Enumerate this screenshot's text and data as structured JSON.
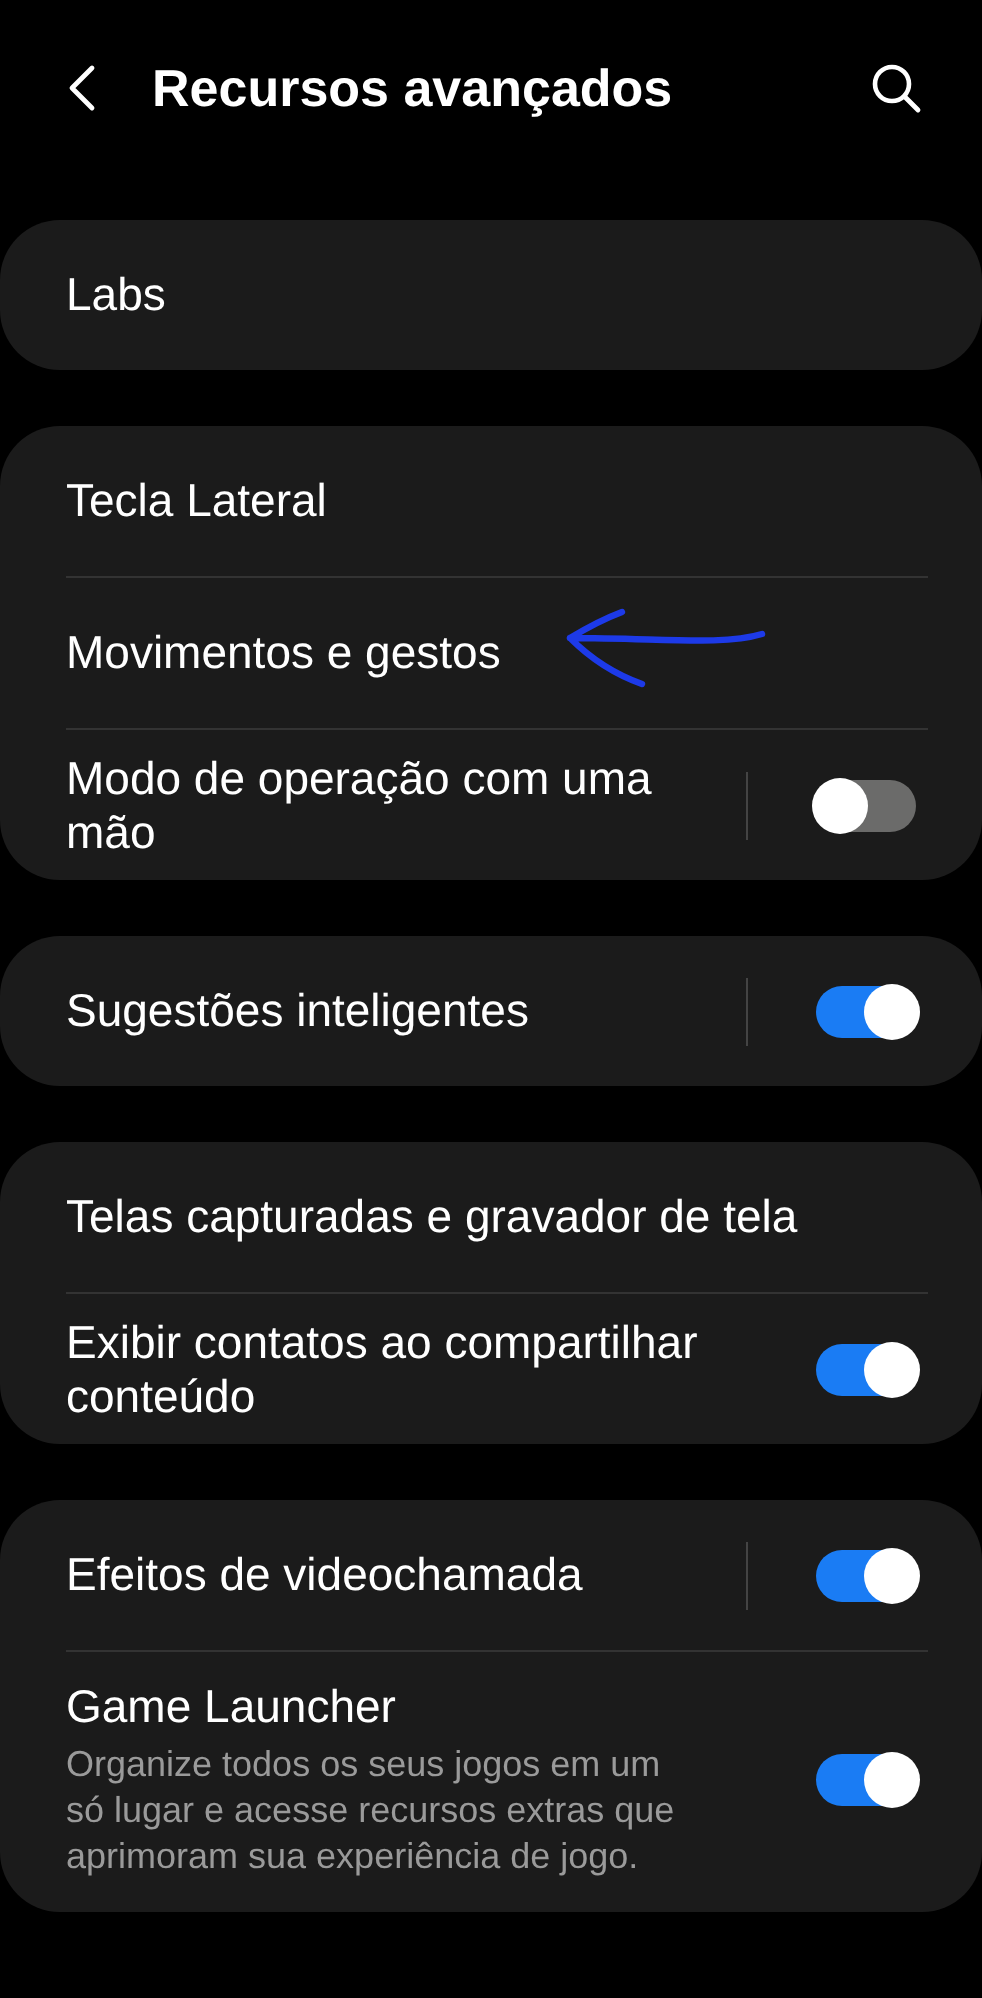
{
  "header": {
    "title": "Recursos avançados"
  },
  "groups": [
    {
      "items": [
        {
          "kind": "link",
          "title": "Labs"
        }
      ]
    },
    {
      "items": [
        {
          "kind": "link",
          "title": "Tecla Lateral"
        },
        {
          "kind": "link",
          "title": "Movimentos e gestos",
          "annotated": true
        },
        {
          "kind": "split-switch",
          "title": "Modo de operação com uma mão",
          "on": false
        }
      ]
    },
    {
      "items": [
        {
          "kind": "split-switch",
          "title": "Sugestões inteligentes",
          "on": true
        }
      ]
    },
    {
      "items": [
        {
          "kind": "link",
          "title": "Telas capturadas e gravador de tela"
        },
        {
          "kind": "switch",
          "title": "Exibir contatos ao compartilhar conteúdo",
          "on": true
        }
      ]
    },
    {
      "items": [
        {
          "kind": "split-switch",
          "title": "Efeitos de videochamada",
          "on": true
        },
        {
          "kind": "switch",
          "title": "Game Launcher",
          "subtitle": "Organize todos os seus jogos em um só lugar e acesse recursos extras que aprimoram sua experiência de jogo.",
          "on": true
        }
      ]
    }
  ]
}
